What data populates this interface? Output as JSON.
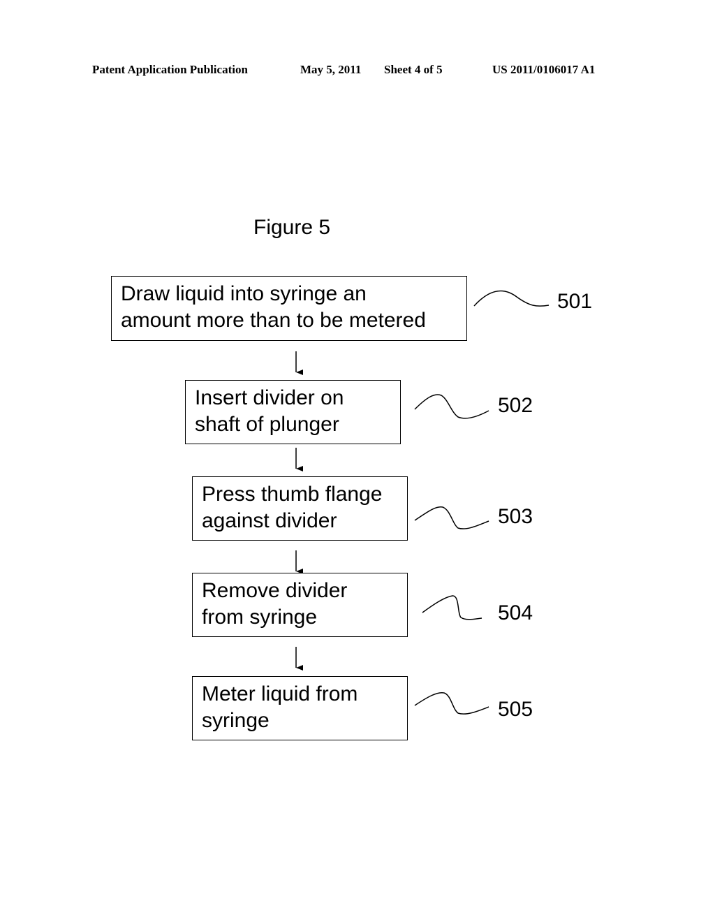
{
  "header": {
    "publication": "Patent Application Publication",
    "date": "May 5, 2011",
    "sheet": "Sheet 4 of 5",
    "number": "US 2011/0106017 A1"
  },
  "figure": {
    "title": "Figure 5",
    "steps": [
      {
        "line1": "Draw liquid into syringe an",
        "line2": "amount more than to be metered",
        "ref": "501"
      },
      {
        "line1": "Insert divider on",
        "line2": "shaft of plunger",
        "ref": "502"
      },
      {
        "line1": "Press thumb flange",
        "line2": "against divider",
        "ref": "503"
      },
      {
        "line1": "Remove divider",
        "line2": "from syringe",
        "ref": "504"
      },
      {
        "line1": "Meter liquid from",
        "line2": "syringe",
        "ref": "505"
      }
    ]
  }
}
